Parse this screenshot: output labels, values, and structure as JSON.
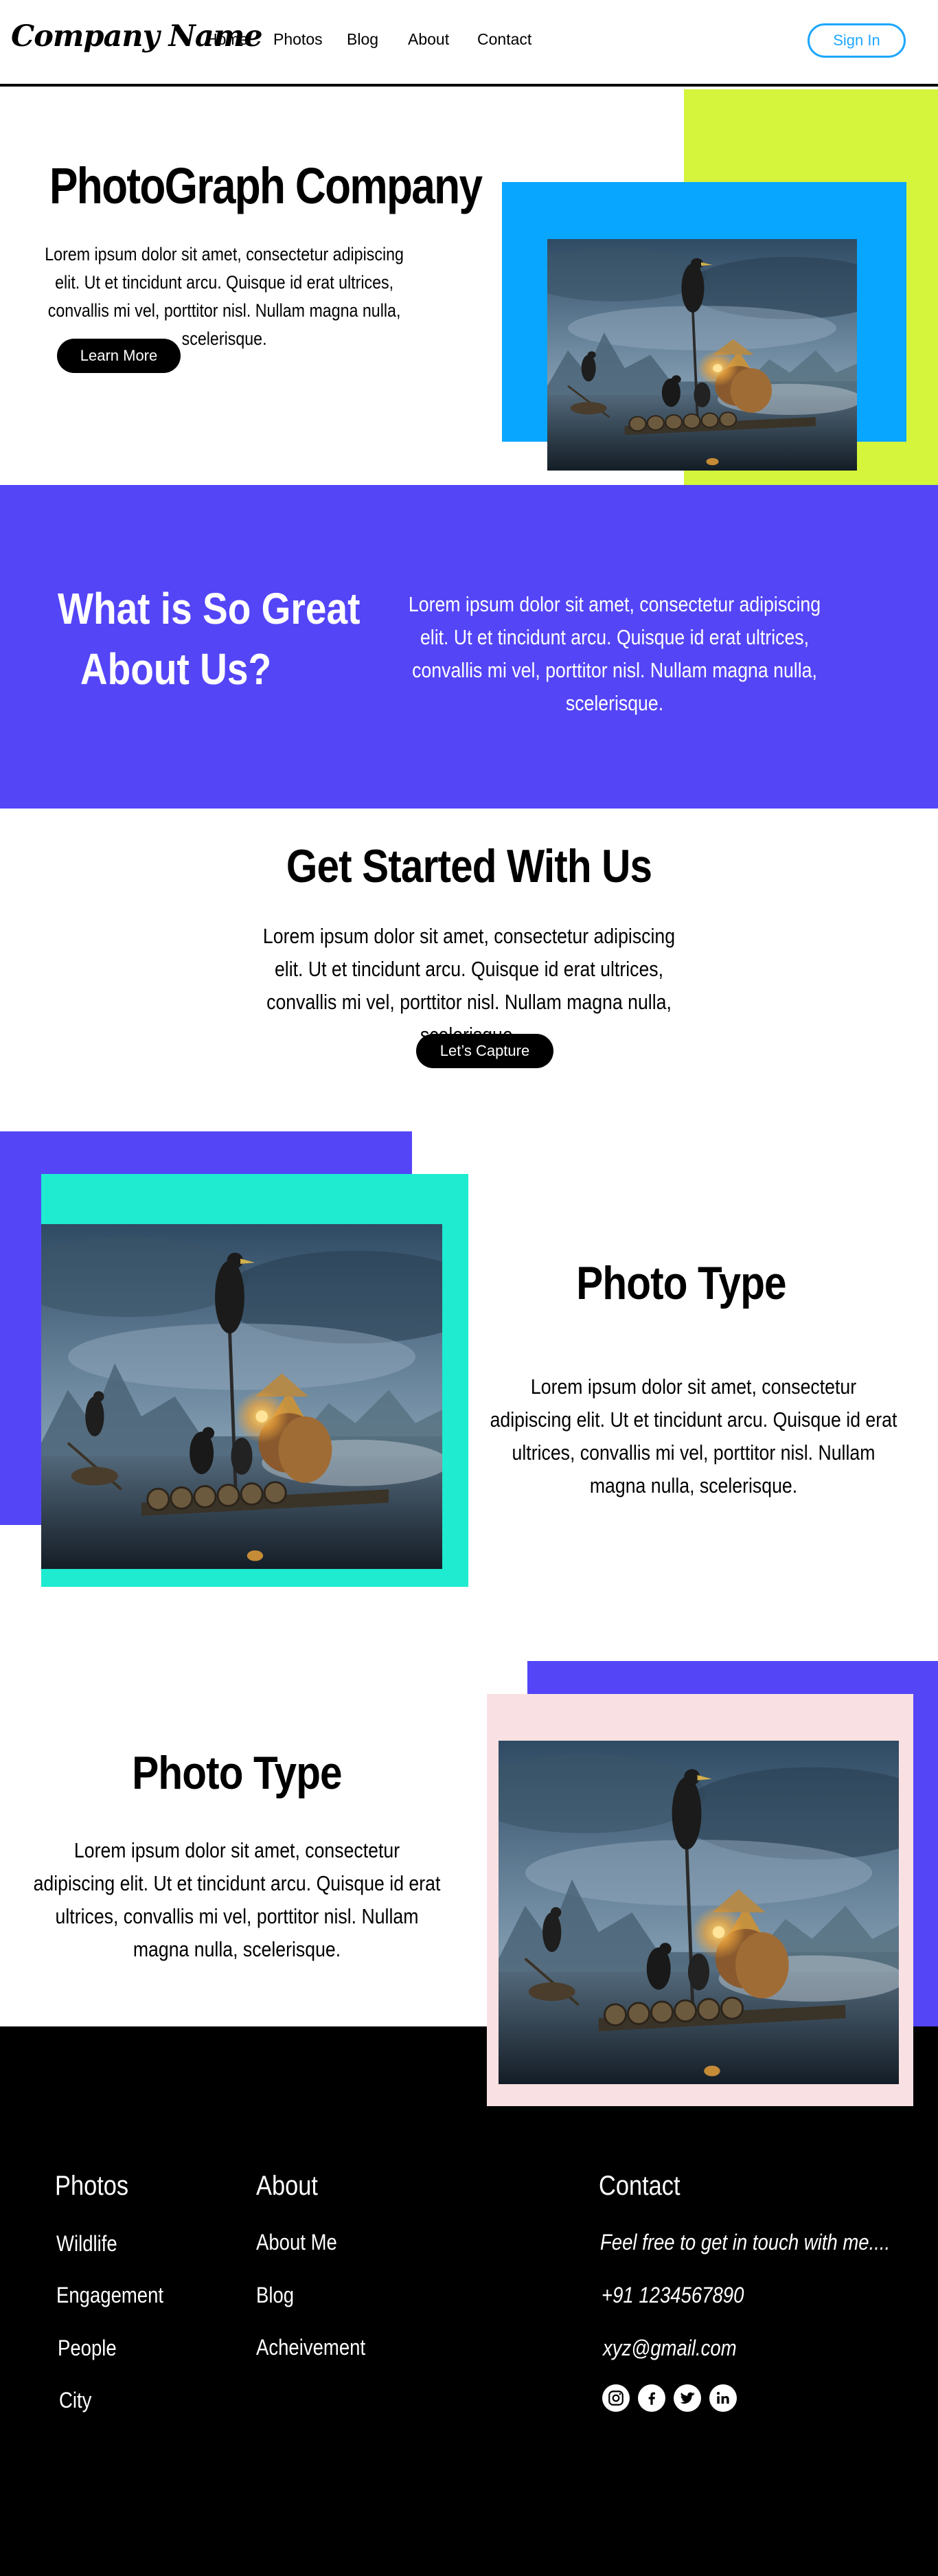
{
  "header": {
    "brand": "Company Name",
    "nav": [
      "Home",
      "Photos",
      "Blog",
      "About",
      "Contact"
    ],
    "signin_label": "Sign In"
  },
  "hero": {
    "title": "PhotoGraph Company",
    "text": "Lorem ipsum dolor sit amet, consectetur adipiscing elit. Ut et tincidunt arcu. Quisque id erat ultrices, convallis mi vel, porttitor nisl. Nullam magna nulla, scelerisque.",
    "button_label": "Learn More"
  },
  "about_band": {
    "title_line1": "What is So Great",
    "title_line2": "About Us?",
    "text": "Lorem ipsum dolor sit amet, consectetur adipiscing elit. Ut et tincidunt arcu. Quisque id erat ultrices, convallis mi vel, porttitor nisl. Nullam magna nulla, scelerisque."
  },
  "get_started": {
    "title": "Get Started With Us",
    "text": "Lorem ipsum dolor sit amet, consectetur adipiscing elit. Ut et tincidunt arcu. Quisque id erat ultrices, convallis mi vel, porttitor nisl. Nullam magna nulla, scelerisque.",
    "button_label": "Let’s Capture"
  },
  "section1": {
    "title": "Photo Type",
    "text": "Lorem ipsum dolor sit amet, consectetur adipiscing elit. Ut et tincidunt arcu. Quisque id erat ultrices, convallis mi vel, porttitor nisl. Nullam magna nulla, scelerisque."
  },
  "section2": {
    "title": "Photo Type",
    "text": "Lorem ipsum dolor sit amet, consectetur adipiscing elit. Ut et tincidunt arcu. Quisque id erat ultrices, convallis mi vel, porttitor nisl. Nullam magna nulla, scelerisque."
  },
  "footer": {
    "photos_heading": "Photos",
    "photos_links": [
      "Wildlife",
      "Engagement",
      "People",
      "City"
    ],
    "about_heading": "About",
    "about_links": [
      "About Me",
      "Blog",
      "Acheivement"
    ],
    "contact_heading": "Contact",
    "contact_tagline": "Feel free to get in touch with me....",
    "contact_phone": "+91 1234567890",
    "contact_email": "xyz@gmail.com",
    "social_icons": [
      "instagram-icon",
      "facebook-icon",
      "twitter-icon",
      "linkedin-icon"
    ]
  },
  "colors": {
    "accent_blue": "#09a6ff",
    "lime": "#d4f53c",
    "purple": "#5445f7",
    "teal": "#1eebd0",
    "pink": "#f9e1e3",
    "signin_blue": "#1ea7ff"
  }
}
